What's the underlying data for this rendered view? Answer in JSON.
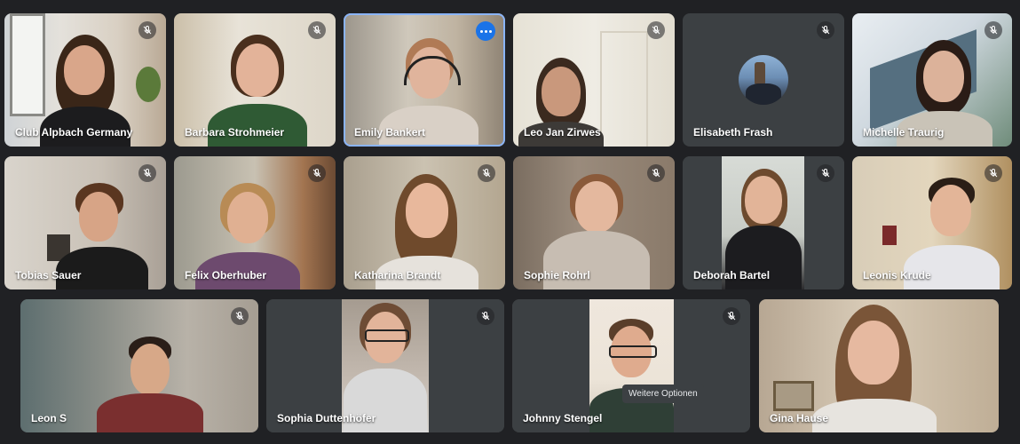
{
  "participants": [
    {
      "name": "Club Alpbach Germany",
      "muted": true
    },
    {
      "name": "Barbara Strohmeier",
      "muted": true
    },
    {
      "name": "Emily Bankert",
      "muted": false,
      "active": true
    },
    {
      "name": "Leo Jan Zirwes",
      "muted": true
    },
    {
      "name": "Elisabeth Frash",
      "muted": true,
      "avatar": true
    },
    {
      "name": "Michelle Traurig",
      "muted": true
    },
    {
      "name": "Tobias Sauer",
      "muted": true
    },
    {
      "name": "Felix Oberhuber",
      "muted": true
    },
    {
      "name": "Katharina Brandt",
      "muted": true
    },
    {
      "name": "Sophie Rohrl",
      "muted": true
    },
    {
      "name": "Deborah Bartel",
      "muted": true
    },
    {
      "name": "Leonis Krude",
      "muted": true
    },
    {
      "name": "Leon S",
      "muted": true
    },
    {
      "name": "Sophia Duttenhöfer",
      "muted": true
    },
    {
      "name": "Johnny Stengel",
      "muted": true
    },
    {
      "name": "Gina Hause",
      "muted": false
    }
  ],
  "tooltip": "Weitere Optionen",
  "icons": {
    "mic": "mic-off-icon",
    "more": "more-options-icon"
  },
  "colors": {
    "background": "#202124",
    "accent": "#1a73e8",
    "active_border": "#8ab4f8"
  }
}
